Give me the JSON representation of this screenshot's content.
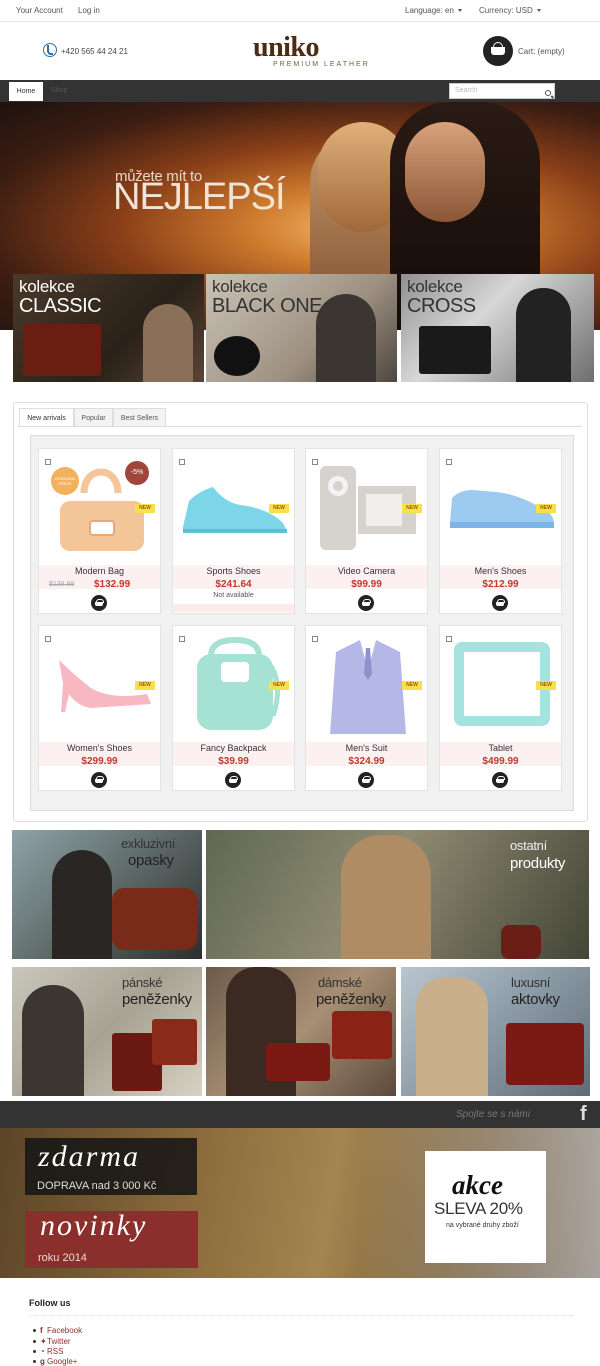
{
  "topbar": {
    "account": "Your Account",
    "login": "Log in",
    "language_label": "Language: en",
    "currency_label": "Currency: USD"
  },
  "header": {
    "phone": "+420 565 44 24 21",
    "logo": "uniko",
    "logo_sub": "PREMIUM LEATHER",
    "cart": "Cart: (empty)"
  },
  "nav": {
    "home": "Home",
    "shop": "Shop",
    "search_placeholder": "Search"
  },
  "hero": {
    "line1": "můžete mít to",
    "line2": "NEJLEPŠÍ"
  },
  "collections": [
    {
      "line1": "kolekce",
      "line2": "CLASSIC"
    },
    {
      "line1": "kolekce",
      "line2": "BLACK ONE"
    },
    {
      "line1": "kolekce",
      "line2": "CROSS"
    }
  ],
  "tabs": [
    "New arrivals",
    "Popular",
    "Best Sellers"
  ],
  "products": [
    {
      "name": "Modern Bag",
      "price": "$132.99",
      "old_price": "$139.99",
      "discount": "-5%",
      "badge": "REDUCED PRICE!",
      "new": "NEW",
      "icon": "handbag"
    },
    {
      "name": "Sports Shoes",
      "price": "$241.64",
      "availability": "Not available",
      "new": "NEW",
      "icon": "sneaker"
    },
    {
      "name": "Video Camera",
      "price": "$99.99",
      "new": "NEW",
      "icon": "camera"
    },
    {
      "name": "Men's Shoes",
      "price": "$212.99",
      "new": "NEW",
      "icon": "shoe"
    },
    {
      "name": "Women's Shoes",
      "price": "$299.99",
      "new": "NEW",
      "icon": "heel"
    },
    {
      "name": "Fancy Backpack",
      "price": "$39.99",
      "new": "NEW",
      "icon": "backpack"
    },
    {
      "name": "Men's Suit",
      "price": "$324.99",
      "new": "NEW",
      "icon": "suit"
    },
    {
      "name": "Tablet",
      "price": "$499.99",
      "new": "NEW",
      "icon": "tablet"
    }
  ],
  "banners": [
    {
      "line1": "exkluzivní",
      "line2": "opasky"
    },
    {
      "line1": "ostatní",
      "line2": "produkty"
    },
    {
      "line1": "pánské",
      "line2": "peněženky"
    },
    {
      "line1": "dámské",
      "line2": "peněženky"
    },
    {
      "line1": "luxusní",
      "line2": "aktovky"
    }
  ],
  "social": {
    "text": "Spojte se s námi"
  },
  "promo": {
    "zdarma": "zdarma",
    "doprava": "DOPRAVA nad 3 000 Kč",
    "novinky": "novinky",
    "roku": "roku 2014",
    "akce": "akce",
    "sleva": "SLEVA 20%",
    "sleva_sub": "na vybrané druhy zboží"
  },
  "footer": {
    "follow": "Follow us",
    "links": [
      "Facebook",
      "Twitter",
      "RSS",
      "Google+"
    ]
  },
  "colors": {
    "accent": "#c0392b",
    "nav_bg": "#333333",
    "brand": "#4d2a12",
    "promo_red": "#8a2f2c"
  }
}
